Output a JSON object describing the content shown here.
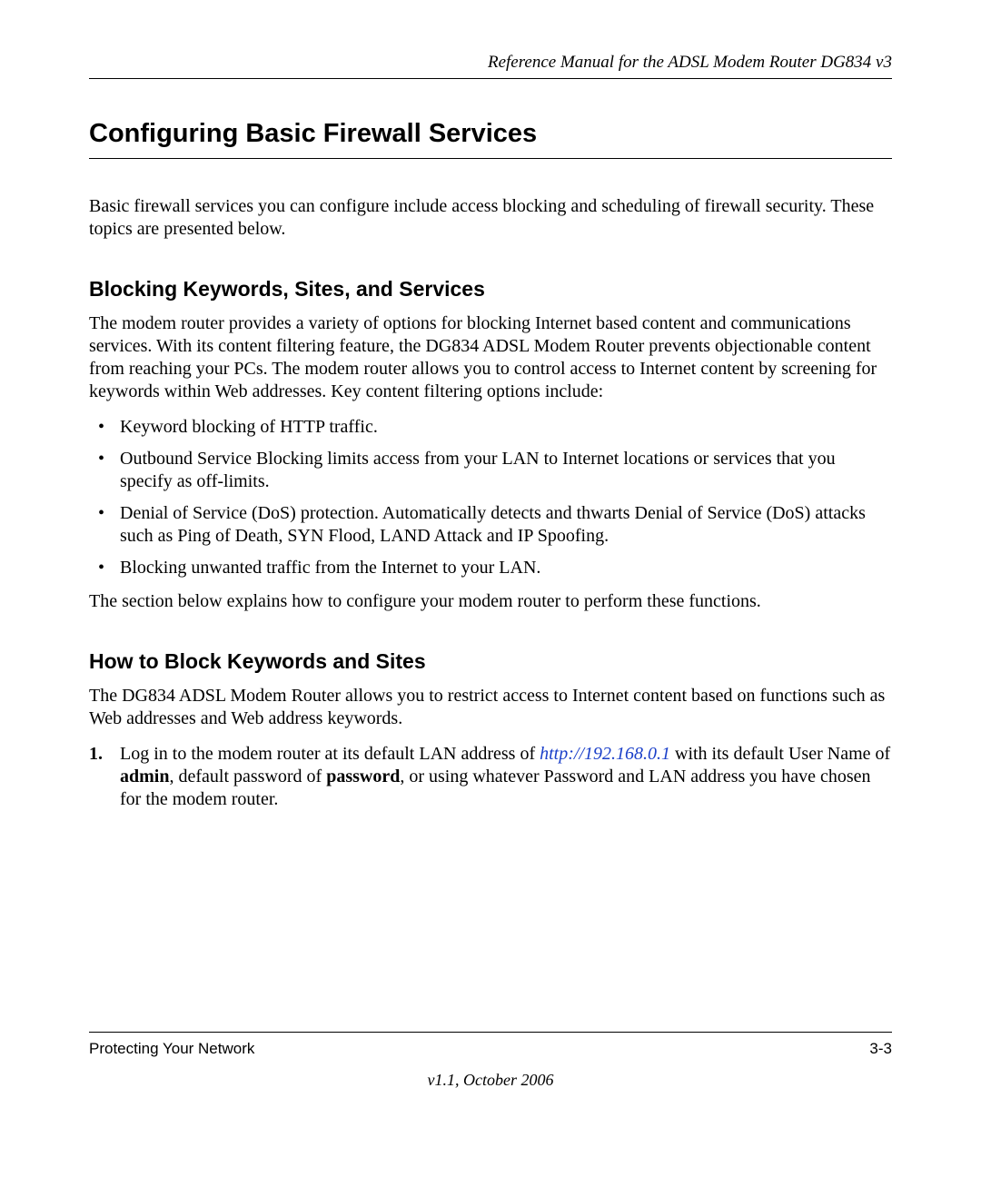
{
  "header": {
    "doc_title": "Reference Manual for the ADSL Modem Router DG834 v3"
  },
  "section": {
    "h1": "Configuring Basic Firewall Services",
    "intro": "Basic firewall services you can configure include access blocking and scheduling of firewall security. These topics are presented below.",
    "sub1": {
      "title": "Blocking Keywords, Sites, and Services",
      "p1": "The modem router provides a variety of options for blocking Internet based content and communications services. With its content filtering feature, the DG834 ADSL Modem Router prevents objectionable content from reaching your PCs. The modem router allows you to control access to Internet content by screening for keywords within Web addresses. Key content filtering options include:",
      "bullets": [
        "Keyword blocking of HTTP traffic.",
        "Outbound Service Blocking limits access from your LAN to Internet locations or services that you specify as off-limits.",
        "Denial of Service (DoS) protection. Automatically detects and thwarts Denial of Service (DoS) attacks such as Ping of Death, SYN Flood, LAND Attack and IP Spoofing.",
        "Blocking unwanted traffic from the Internet to your LAN."
      ],
      "p2": "The section below explains how to configure your modem router to perform these functions."
    },
    "sub2": {
      "title": "How to Block Keywords and Sites",
      "p1": "The DG834 ADSL Modem Router allows you to restrict access to Internet content based on functions such as Web addresses and Web address keywords.",
      "step1": {
        "num": "1.",
        "t1": "Log in to the modem router at its default LAN address of ",
        "link": "http://192.168.0.1",
        "t2": " with its default User Name of ",
        "b1": "admin",
        "t3": ", default password of ",
        "b2": "password",
        "t4": ", or using whatever Password and LAN address you have chosen for the modem router."
      }
    }
  },
  "footer": {
    "section_name": "Protecting Your Network",
    "page_num": "3-3",
    "version": "v1.1, October 2006"
  }
}
